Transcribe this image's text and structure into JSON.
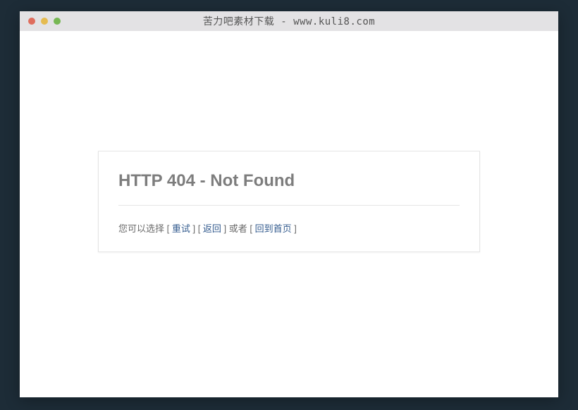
{
  "window": {
    "title": "苦力吧素材下载 - www.kuli8.com"
  },
  "error": {
    "heading": "HTTP 404 - Not Found",
    "prefix": "您可以选择 [ ",
    "retry": "重试",
    "sep1": " ] [ ",
    "back": "返回",
    "sep2": " ] 或者 [ ",
    "home": "回到首页",
    "suffix": " ]"
  }
}
